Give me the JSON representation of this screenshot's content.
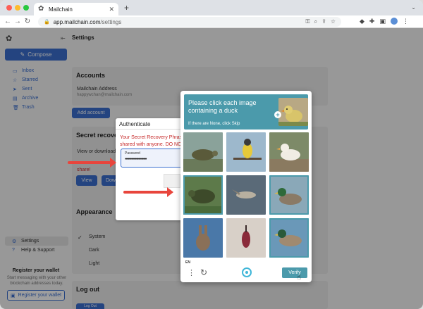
{
  "browser": {
    "tab_title": "Mailchain",
    "url_host": "app.mailchain.com",
    "url_path": "/settings"
  },
  "sidebar": {
    "compose_label": "Compose",
    "items": [
      {
        "label": "Inbox",
        "icon": "inbox-icon"
      },
      {
        "label": "Starred",
        "icon": "star-icon"
      },
      {
        "label": "Sent",
        "icon": "send-icon"
      },
      {
        "label": "Archive",
        "icon": "archive-icon"
      },
      {
        "label": "Trash",
        "icon": "trash-icon"
      }
    ],
    "settings_label": "Settings",
    "help_label": "Help & Support",
    "register_title": "Register your wallet",
    "register_text": "Start messaging with your other blockchain addresses today.",
    "register_button": "Register your wallet"
  },
  "settings": {
    "page_title": "Settings",
    "accounts": {
      "title": "Accounts",
      "address_label": "Mailchain Address",
      "address_value": "happywchan@mailchain.com",
      "add_button": "Add account"
    },
    "secret": {
      "title": "Secret recover",
      "text": "View or download",
      "share_text": "share!",
      "view_button": "View",
      "download_button": "Dow"
    },
    "appearance": {
      "title": "Appearance",
      "options": [
        "System",
        "Dark",
        "Light"
      ]
    },
    "logout": {
      "title": "Log out",
      "button": "Log Out"
    }
  },
  "auth_modal": {
    "title": "Authenticate",
    "warning": "Your Secret Recovery Phras shared with anyone. DO NOT",
    "password_label": "Password",
    "password_value": "•••••••••••••••••••••"
  },
  "captcha": {
    "prompt": "Please click each image containing a duck",
    "subtext": "If there are None, click Skip",
    "language": "EN",
    "verify_label": "Verify",
    "colors": {
      "accent": "#4b9aab"
    }
  }
}
